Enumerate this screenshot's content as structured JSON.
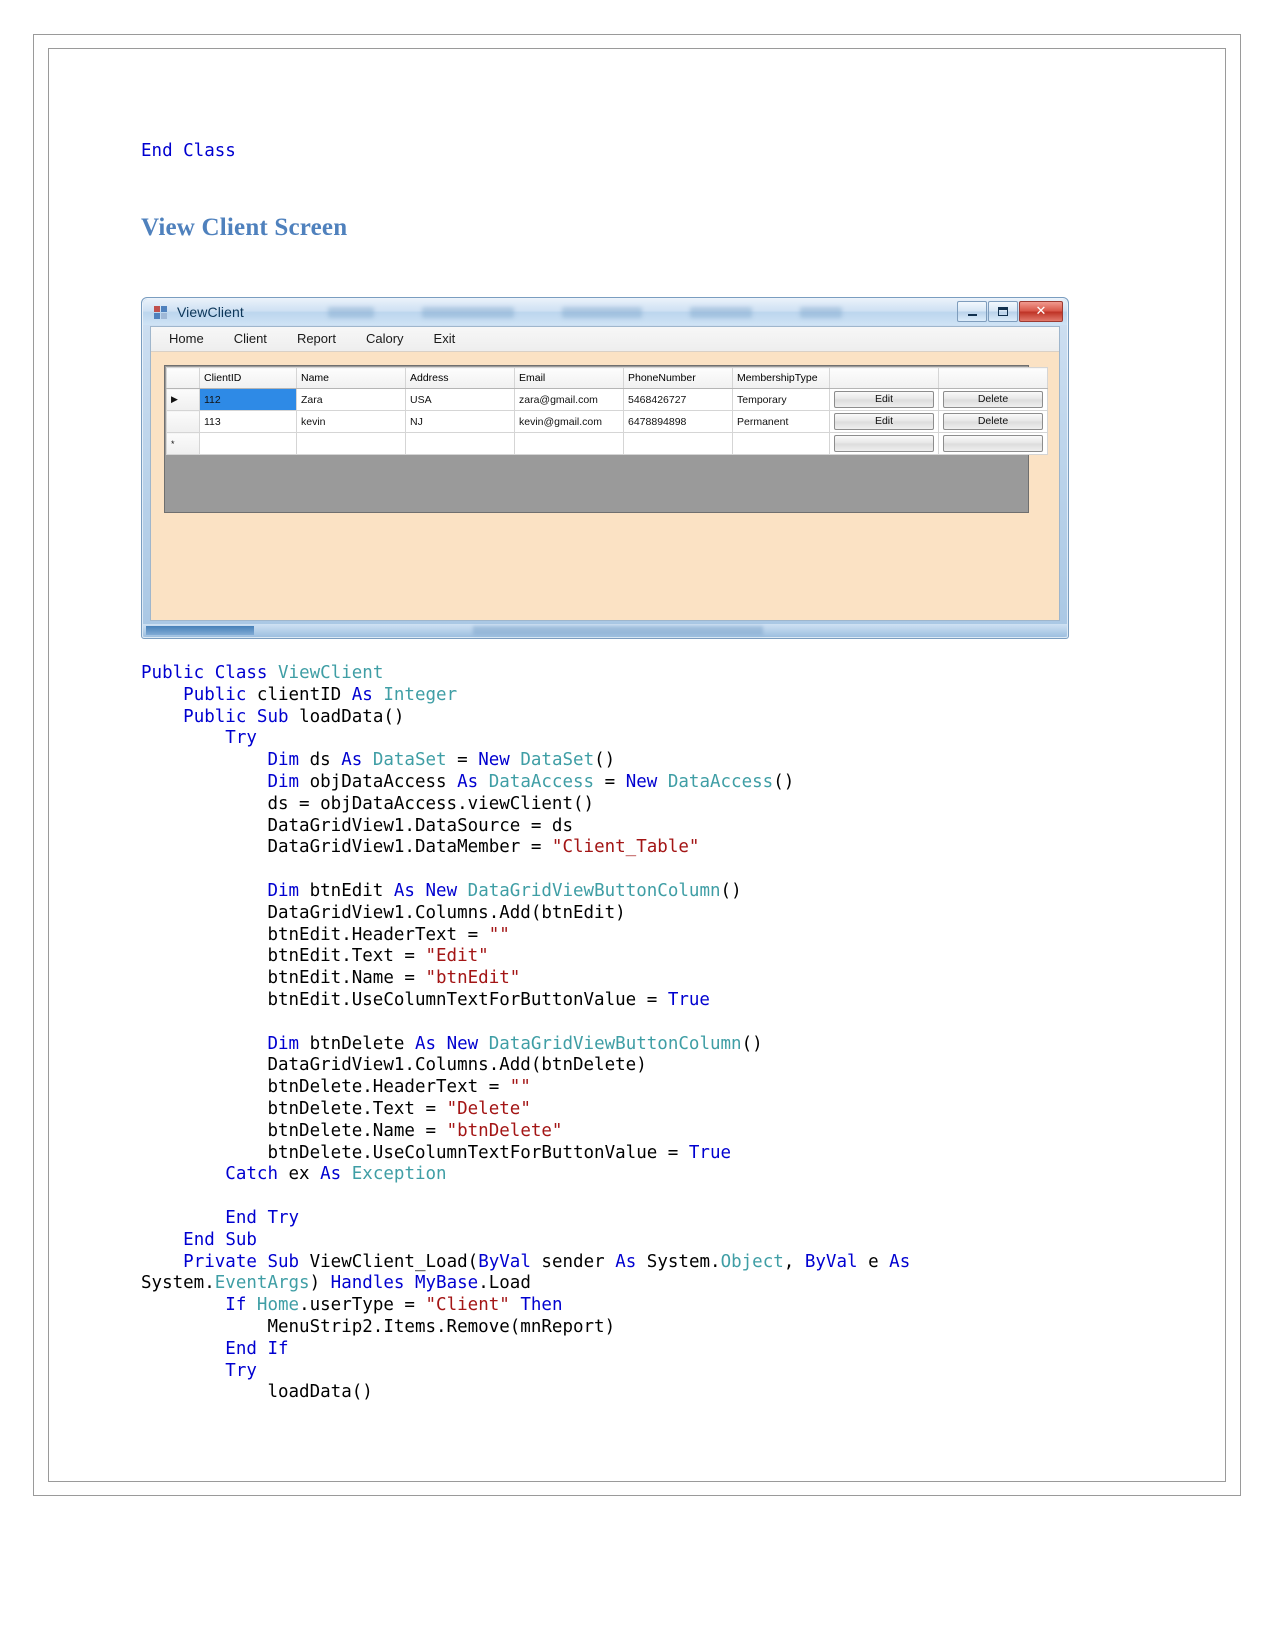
{
  "document": {
    "pre_heading_code": "End Class",
    "heading": "View Client Screen"
  },
  "screenshot": {
    "window": {
      "title": "ViewClient",
      "icon": "vb-form-icon",
      "controls": {
        "minimize": "minimize-button",
        "maximize": "maximize-button",
        "close_label": "✕"
      }
    },
    "menubar": {
      "items": [
        "Home",
        "Client",
        "Report",
        "Calory",
        "Exit"
      ]
    },
    "datagrid": {
      "columns": [
        "ClientID",
        "Name",
        "Address",
        "Email",
        "PhoneNumber",
        "MembershipType",
        "",
        ""
      ],
      "rows": [
        {
          "marker": "▶",
          "selected": true,
          "ClientID": "112",
          "Name": "Zara",
          "Address": "USA",
          "Email": "zara@gmail.com",
          "PhoneNumber": "5468426727",
          "MembershipType": "Temporary",
          "edit_label": "Edit",
          "delete_label": "Delete"
        },
        {
          "marker": "",
          "selected": false,
          "ClientID": "113",
          "Name": "kevin",
          "Address": "NJ",
          "Email": "kevin@gmail.com",
          "PhoneNumber": "6478894898",
          "MembershipType": "Permanent",
          "edit_label": "Edit",
          "delete_label": "Delete"
        },
        {
          "marker": "*",
          "selected": false,
          "ClientID": "",
          "Name": "",
          "Address": "",
          "Email": "",
          "PhoneNumber": "",
          "MembershipType": "",
          "edit_label": "",
          "delete_label": ""
        }
      ]
    },
    "colors": {
      "form_background": "#fbe2c4",
      "selection": "#2e8ae6",
      "grid_backdrop": "#9a9a9a",
      "titlebar": "#cfe1f3",
      "close_button": "#bf3427"
    }
  },
  "code": {
    "language": "vb.net",
    "colors": {
      "keyword": "#0000d0",
      "type": "#3f9ea5",
      "string": "#a31515",
      "plain": "#000000"
    },
    "lines": [
      [
        {
          "t": "Public",
          "c": "kw"
        },
        {
          "t": " ",
          "c": "plain"
        },
        {
          "t": "Class",
          "c": "kw"
        },
        {
          "t": " ",
          "c": "plain"
        },
        {
          "t": "ViewClient",
          "c": "typ"
        }
      ],
      [
        {
          "t": "    ",
          "c": "plain"
        },
        {
          "t": "Public",
          "c": "kw"
        },
        {
          "t": " clientID ",
          "c": "plain"
        },
        {
          "t": "As",
          "c": "kw"
        },
        {
          "t": " ",
          "c": "plain"
        },
        {
          "t": "Integer",
          "c": "typ"
        }
      ],
      [
        {
          "t": "    ",
          "c": "plain"
        },
        {
          "t": "Public",
          "c": "kw"
        },
        {
          "t": " ",
          "c": "plain"
        },
        {
          "t": "Sub",
          "c": "kw"
        },
        {
          "t": " loadData()",
          "c": "plain"
        }
      ],
      [
        {
          "t": "        ",
          "c": "plain"
        },
        {
          "t": "Try",
          "c": "kw"
        }
      ],
      [
        {
          "t": "            ",
          "c": "plain"
        },
        {
          "t": "Dim",
          "c": "kw"
        },
        {
          "t": " ds ",
          "c": "plain"
        },
        {
          "t": "As",
          "c": "kw"
        },
        {
          "t": " ",
          "c": "plain"
        },
        {
          "t": "DataSet",
          "c": "typ"
        },
        {
          "t": " = ",
          "c": "plain"
        },
        {
          "t": "New",
          "c": "kw"
        },
        {
          "t": " ",
          "c": "plain"
        },
        {
          "t": "DataSet",
          "c": "typ"
        },
        {
          "t": "()",
          "c": "plain"
        }
      ],
      [
        {
          "t": "            ",
          "c": "plain"
        },
        {
          "t": "Dim",
          "c": "kw"
        },
        {
          "t": " objDataAccess ",
          "c": "plain"
        },
        {
          "t": "As",
          "c": "kw"
        },
        {
          "t": " ",
          "c": "plain"
        },
        {
          "t": "DataAccess",
          "c": "typ"
        },
        {
          "t": " = ",
          "c": "plain"
        },
        {
          "t": "New",
          "c": "kw"
        },
        {
          "t": " ",
          "c": "plain"
        },
        {
          "t": "DataAccess",
          "c": "typ"
        },
        {
          "t": "()",
          "c": "plain"
        }
      ],
      [
        {
          "t": "            ds = objDataAccess.viewClient()",
          "c": "plain"
        }
      ],
      [
        {
          "t": "            DataGridView1.DataSource = ds",
          "c": "plain"
        }
      ],
      [
        {
          "t": "            DataGridView1.DataMember = ",
          "c": "plain"
        },
        {
          "t": "\"Client_Table\"",
          "c": "str"
        }
      ],
      [
        {
          "t": "",
          "c": "plain"
        }
      ],
      [
        {
          "t": "            ",
          "c": "plain"
        },
        {
          "t": "Dim",
          "c": "kw"
        },
        {
          "t": " btnEdit ",
          "c": "plain"
        },
        {
          "t": "As",
          "c": "kw"
        },
        {
          "t": " ",
          "c": "plain"
        },
        {
          "t": "New",
          "c": "kw"
        },
        {
          "t": " ",
          "c": "plain"
        },
        {
          "t": "DataGridViewButtonColumn",
          "c": "typ"
        },
        {
          "t": "()",
          "c": "plain"
        }
      ],
      [
        {
          "t": "            DataGridView1.Columns.Add(btnEdit)",
          "c": "plain"
        }
      ],
      [
        {
          "t": "            btnEdit.HeaderText = ",
          "c": "plain"
        },
        {
          "t": "\"\"",
          "c": "str"
        }
      ],
      [
        {
          "t": "            btnEdit.Text = ",
          "c": "plain"
        },
        {
          "t": "\"Edit\"",
          "c": "str"
        }
      ],
      [
        {
          "t": "            btnEdit.Name = ",
          "c": "plain"
        },
        {
          "t": "\"btnEdit\"",
          "c": "str"
        }
      ],
      [
        {
          "t": "            btnEdit.UseColumnTextForButtonValue = ",
          "c": "plain"
        },
        {
          "t": "True",
          "c": "kw"
        }
      ],
      [
        {
          "t": "",
          "c": "plain"
        }
      ],
      [
        {
          "t": "            ",
          "c": "plain"
        },
        {
          "t": "Dim",
          "c": "kw"
        },
        {
          "t": " btnDelete ",
          "c": "plain"
        },
        {
          "t": "As",
          "c": "kw"
        },
        {
          "t": " ",
          "c": "plain"
        },
        {
          "t": "New",
          "c": "kw"
        },
        {
          "t": " ",
          "c": "plain"
        },
        {
          "t": "DataGridViewButtonColumn",
          "c": "typ"
        },
        {
          "t": "()",
          "c": "plain"
        }
      ],
      [
        {
          "t": "            DataGridView1.Columns.Add(btnDelete)",
          "c": "plain"
        }
      ],
      [
        {
          "t": "            btnDelete.HeaderText = ",
          "c": "plain"
        },
        {
          "t": "\"\"",
          "c": "str"
        }
      ],
      [
        {
          "t": "            btnDelete.Text = ",
          "c": "plain"
        },
        {
          "t": "\"Delete\"",
          "c": "str"
        }
      ],
      [
        {
          "t": "            btnDelete.Name = ",
          "c": "plain"
        },
        {
          "t": "\"btnDelete\"",
          "c": "str"
        }
      ],
      [
        {
          "t": "            btnDelete.UseColumnTextForButtonValue = ",
          "c": "plain"
        },
        {
          "t": "True",
          "c": "kw"
        }
      ],
      [
        {
          "t": "        ",
          "c": "plain"
        },
        {
          "t": "Catch",
          "c": "kw"
        },
        {
          "t": " ex ",
          "c": "plain"
        },
        {
          "t": "As",
          "c": "kw"
        },
        {
          "t": " ",
          "c": "plain"
        },
        {
          "t": "Exception",
          "c": "typ"
        }
      ],
      [
        {
          "t": "",
          "c": "plain"
        }
      ],
      [
        {
          "t": "        ",
          "c": "plain"
        },
        {
          "t": "End",
          "c": "kw"
        },
        {
          "t": " ",
          "c": "plain"
        },
        {
          "t": "Try",
          "c": "kw"
        }
      ],
      [
        {
          "t": "    ",
          "c": "plain"
        },
        {
          "t": "End",
          "c": "kw"
        },
        {
          "t": " ",
          "c": "plain"
        },
        {
          "t": "Sub",
          "c": "kw"
        }
      ],
      [
        {
          "t": "    ",
          "c": "plain"
        },
        {
          "t": "Private",
          "c": "kw"
        },
        {
          "t": " ",
          "c": "plain"
        },
        {
          "t": "Sub",
          "c": "kw"
        },
        {
          "t": " ViewClient_Load(",
          "c": "plain"
        },
        {
          "t": "ByVal",
          "c": "kw"
        },
        {
          "t": " sender ",
          "c": "plain"
        },
        {
          "t": "As",
          "c": "kw"
        },
        {
          "t": " System.",
          "c": "plain"
        },
        {
          "t": "Object",
          "c": "typ"
        },
        {
          "t": ", ",
          "c": "plain"
        },
        {
          "t": "ByVal",
          "c": "kw"
        },
        {
          "t": " e ",
          "c": "plain"
        },
        {
          "t": "As",
          "c": "kw"
        }
      ],
      [
        {
          "t": "System.",
          "c": "plain"
        },
        {
          "t": "EventArgs",
          "c": "typ"
        },
        {
          "t": ") ",
          "c": "plain"
        },
        {
          "t": "Handles",
          "c": "kw"
        },
        {
          "t": " ",
          "c": "plain"
        },
        {
          "t": "MyBase",
          "c": "kw"
        },
        {
          "t": ".Load",
          "c": "plain"
        }
      ],
      [
        {
          "t": "        ",
          "c": "plain"
        },
        {
          "t": "If",
          "c": "kw"
        },
        {
          "t": " ",
          "c": "plain"
        },
        {
          "t": "Home",
          "c": "typ"
        },
        {
          "t": ".userType = ",
          "c": "plain"
        },
        {
          "t": "\"Client\"",
          "c": "str"
        },
        {
          "t": " ",
          "c": "plain"
        },
        {
          "t": "Then",
          "c": "kw"
        }
      ],
      [
        {
          "t": "            MenuStrip2.Items.Remove(mnReport)",
          "c": "plain"
        }
      ],
      [
        {
          "t": "        ",
          "c": "plain"
        },
        {
          "t": "End",
          "c": "kw"
        },
        {
          "t": " ",
          "c": "plain"
        },
        {
          "t": "If",
          "c": "kw"
        }
      ],
      [
        {
          "t": "        ",
          "c": "plain"
        },
        {
          "t": "Try",
          "c": "kw"
        }
      ],
      [
        {
          "t": "            loadData()",
          "c": "plain"
        }
      ]
    ]
  }
}
